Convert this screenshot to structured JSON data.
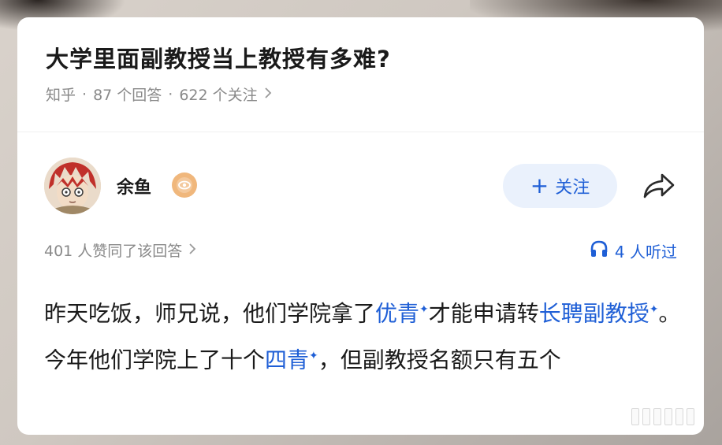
{
  "question": {
    "title": "大学里面副教授当上教授有多难?",
    "source": "知乎",
    "answers": "87 个回答",
    "followers": "622 个关注",
    "dot": "·"
  },
  "author": {
    "name": "余鱼",
    "follow_label": "关注"
  },
  "stats": {
    "likes": "401 人赞同了该回答",
    "listened": "4 人听过"
  },
  "answer": {
    "seg1": "昨天吃饭，师兄说，他们学院拿了",
    "link1": "优青",
    "seg2": "才能申请转",
    "link2": "长聘副教授",
    "seg3": "。今年他们学院上了十个",
    "link3": "四青",
    "seg4": "，但副教授名额只有五个"
  },
  "colors": {
    "accent": "#1f5fd6",
    "follow_bg": "#eaf1fc",
    "muted": "#8a8a8a"
  },
  "icons": {
    "share": "share-icon",
    "headphones": "headphones-icon",
    "badge": "eye-badge-icon"
  }
}
